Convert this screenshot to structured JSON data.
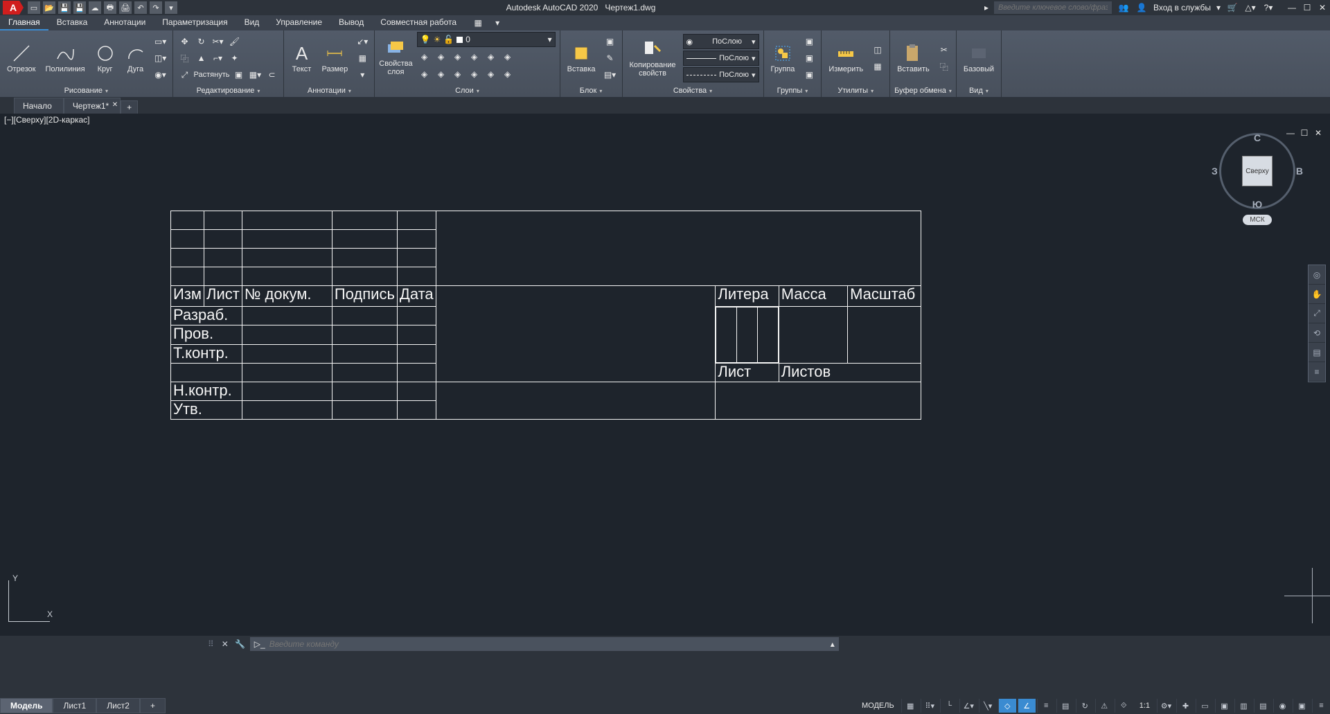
{
  "title": {
    "app": "Autodesk AutoCAD 2020",
    "doc": "Чертеж1.dwg"
  },
  "qat": {
    "undo": "↶",
    "redo": "↷"
  },
  "search_placeholder": "Введите ключевое слово/фразу",
  "signin": "Вход в службы",
  "menu_tabs": [
    "Главная",
    "Вставка",
    "Аннотации",
    "Параметризация",
    "Вид",
    "Управление",
    "Вывод",
    "Совместная работа"
  ],
  "ribbon": {
    "draw": {
      "label": "Рисование",
      "line": "Отрезок",
      "polyline": "Полилиния",
      "circle": "Круг",
      "arc": "Дуга"
    },
    "modify": {
      "label": "Редактирование",
      "stretch": "Растянуть"
    },
    "annot": {
      "label": "Аннотации",
      "text": "Текст",
      "dim": "Размер"
    },
    "layers": {
      "label": "Слои",
      "props": "Свойства\nслоя",
      "current": "0"
    },
    "block": {
      "label": "Блок",
      "insert": "Вставка"
    },
    "props": {
      "label": "Свойства",
      "match": "Копирование\nсвойств",
      "bylayer": "ПоСлою"
    },
    "groups": {
      "label": "Группы",
      "group": "Группа"
    },
    "utils": {
      "label": "Утилиты",
      "measure": "Измерить"
    },
    "clip": {
      "label": "Буфер обмена",
      "paste": "Вставить"
    },
    "view": {
      "label": "Вид",
      "base": "Базовый"
    }
  },
  "filetabs": {
    "start": "Начало",
    "doc": "Чертеж1*"
  },
  "vplabel": "[−][Сверху][2D-каркас]",
  "viewcube": {
    "top": "Сверху",
    "n": "С",
    "s": "Ю",
    "e": "В",
    "w": "З",
    "wcs": "МСК"
  },
  "ucs": {
    "x": "X",
    "y": "Y"
  },
  "cmd": {
    "placeholder": "Введите команду"
  },
  "layouts": {
    "model": "Модель",
    "sheet1": "Лист1",
    "sheet2": "Лист2"
  },
  "status": {
    "model": "МОДЕЛЬ",
    "scale": "1:1"
  },
  "tblock": {
    "izm": "Изм",
    "list": "Лист",
    "docnum": "№ докум.",
    "sign": "Подпись",
    "date": "Дата",
    "razrab": "Разраб.",
    "prov": "Пров.",
    "tkontr": "Т.контр.",
    "nkontr": "Н.контр.",
    "utv": "Утв.",
    "litera": "Литера",
    "massa": "Масса",
    "mashtab": "Масштаб",
    "list2": "Лист",
    "listov": "Листов"
  }
}
